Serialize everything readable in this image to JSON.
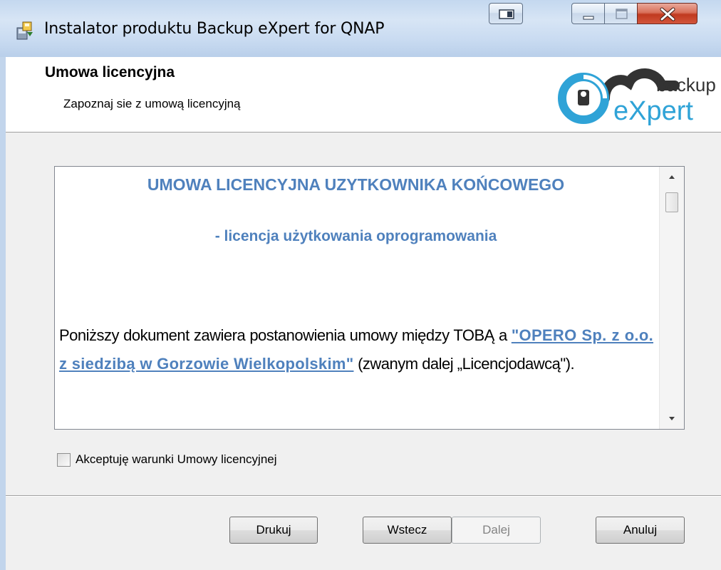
{
  "window": {
    "title": "Instalator produktu Backup eXpert for QNAP"
  },
  "header": {
    "title": "Umowa licencyjna",
    "subtitle": "Zapoznaj sie z umową licencyjną",
    "logo_text_top": "backup",
    "logo_text_bottom": "eXpert"
  },
  "license": {
    "heading": "UMOWA LICENCYJNA UZYTKOWNIKA KOŃCOWEGO",
    "subheading": "- licencja użytkowania oprogramowania",
    "paragraph_before": "Poniższy dokument zawiera postanowienia umowy między TOBĄ a ",
    "paragraph_link": "\"OPERO Sp. z o.o. z siedzibą w Gorzowie Wielkopolskim\"",
    "paragraph_after": " (zwanym dalej „Licencjodawcą\").",
    "scroll_position": 0.05
  },
  "accept": {
    "label": "Akceptuję warunki Umowy licencyjnej",
    "checked": false
  },
  "buttons": {
    "print": "Drukuj",
    "back": "Wstecz",
    "next": "Dalej",
    "cancel": "Anuluj"
  },
  "colors": {
    "accent": "#4f81bd",
    "logo_blue": "#2fa3d7",
    "logo_dark": "#333333"
  }
}
